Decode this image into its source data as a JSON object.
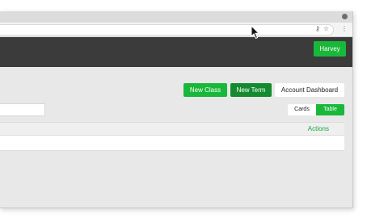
{
  "browser": {
    "omnibox_icons": {
      "key_icon": "⚷",
      "star_icon": "☆",
      "menu_icon": "⋮"
    }
  },
  "appbar": {
    "user_button": "Harvey"
  },
  "actions": {
    "new_class": "New Class",
    "new_term": "New Term",
    "account_dashboard": "Account Dashboard"
  },
  "view_toggle": {
    "cards": "Cards",
    "table": "Table",
    "selected": "Table"
  },
  "table": {
    "columns": [
      "Actions"
    ],
    "rows": [
      {}
    ]
  },
  "colors": {
    "accent": "#19b83a",
    "accent_dark": "#158b2f",
    "appbar": "#3b3b3b"
  }
}
